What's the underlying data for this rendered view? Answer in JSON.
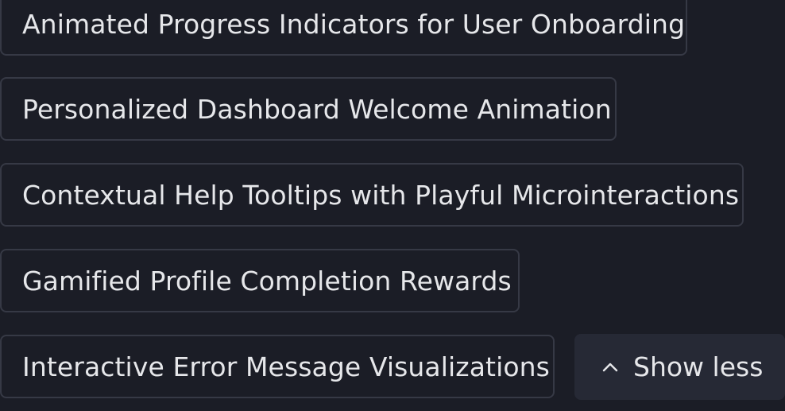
{
  "suggestions": {
    "items": [
      {
        "label": "Animated Progress Indicators for User Onboarding"
      },
      {
        "label": "Personalized Dashboard Welcome Animation"
      },
      {
        "label": "Contextual Help Tooltips with Playful Microinteractions"
      },
      {
        "label": "Gamified Profile Completion Rewards"
      },
      {
        "label": "Interactive Error Message Visualizations"
      }
    ],
    "toggle": {
      "label": "Show less",
      "icon": "chevron-up-icon"
    }
  },
  "colors": {
    "background": "#1b1d26",
    "chip_border": "#363945",
    "toggle_background": "#262935",
    "text": "#e6e7ea"
  }
}
